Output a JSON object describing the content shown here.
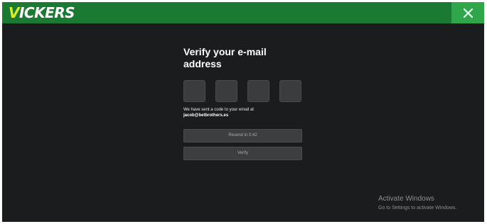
{
  "header": {
    "logo_first_letter": "V",
    "logo_rest": "ICKERS",
    "close_icon": "close-icon",
    "brand_color": "#1a7a32",
    "accent_color": "#d7ee2a"
  },
  "verify": {
    "title": "Verify your e-mail address",
    "code_boxes": [
      "",
      "",
      "",
      ""
    ],
    "sent_message": "We have sent a code to your email at",
    "email": "jacob@betbrothers.es",
    "resend_label": "Resend in 0:42",
    "verify_label": "Verify"
  },
  "watermark": {
    "title": "Activate Windows",
    "subtitle": "Go to Settings to activate Windows."
  }
}
